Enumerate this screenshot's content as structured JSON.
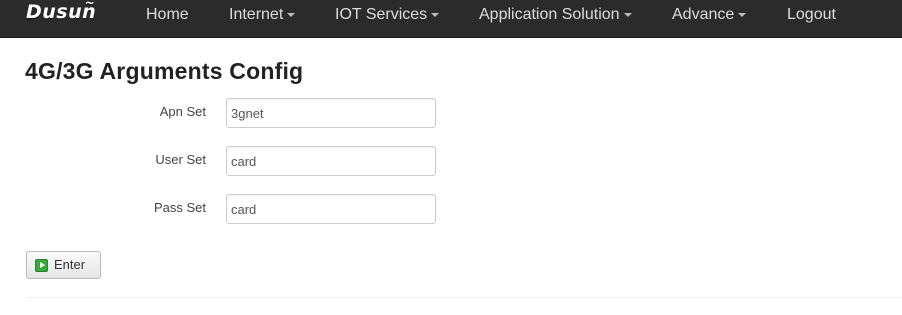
{
  "navbar": {
    "brand": "Dusun",
    "brand_accent": "~",
    "items": [
      {
        "label": "Home",
        "has_dropdown": false
      },
      {
        "label": "Internet",
        "has_dropdown": true
      },
      {
        "label": "IOT Services",
        "has_dropdown": true
      },
      {
        "label": "Application Solution",
        "has_dropdown": true
      },
      {
        "label": "Advance",
        "has_dropdown": true
      },
      {
        "label": "Logout",
        "has_dropdown": false
      }
    ]
  },
  "page": {
    "title": "4G/3G Arguments Config"
  },
  "form": {
    "apn": {
      "label": "Apn Set",
      "value": "3gnet"
    },
    "user": {
      "label": "User Set",
      "value": "card"
    },
    "pass": {
      "label": "Pass Set",
      "value": "card"
    }
  },
  "actions": {
    "enter_label": "Enter"
  },
  "colors": {
    "navbar_bg": "#2b2b2b",
    "enter_icon": "#3aa83a"
  },
  "icons": {
    "enter": "play-arrow-icon"
  }
}
